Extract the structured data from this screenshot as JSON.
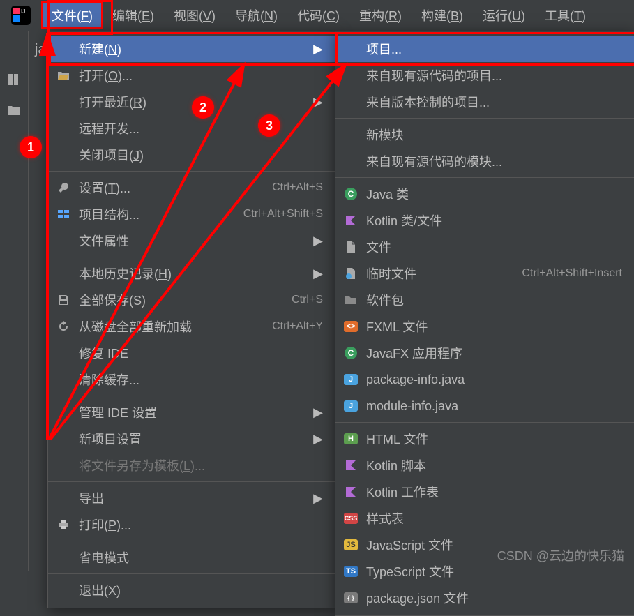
{
  "menubar": {
    "items": [
      {
        "label": "文件",
        "mn": "F"
      },
      {
        "label": "编辑",
        "mn": "E"
      },
      {
        "label": "视图",
        "mn": "V"
      },
      {
        "label": "导航",
        "mn": "N"
      },
      {
        "label": "代码",
        "mn": "C"
      },
      {
        "label": "重构",
        "mn": "R"
      },
      {
        "label": "构建",
        "mn": "B"
      },
      {
        "label": "运行",
        "mn": "U"
      },
      {
        "label": "工具",
        "mn": "T"
      }
    ]
  },
  "proj_label": "java",
  "menu1": [
    {
      "type": "item",
      "label": "新建",
      "mn": "N",
      "arrow": true,
      "hover": true,
      "icon": ""
    },
    {
      "type": "item",
      "label": "打开",
      "mn": "O",
      "suffix": "...",
      "icon": "open"
    },
    {
      "type": "item",
      "label": "打开最近",
      "mn": "R",
      "arrow": true
    },
    {
      "type": "item",
      "label": "远程开发..."
    },
    {
      "type": "item",
      "label": "关闭项目",
      "mn": "J"
    },
    {
      "type": "sep"
    },
    {
      "type": "item",
      "label": "设置",
      "mn": "T",
      "suffix": "...",
      "shortcut": "Ctrl+Alt+S",
      "icon": "wrench"
    },
    {
      "type": "item",
      "label": "项目结构...",
      "shortcut": "Ctrl+Alt+Shift+S",
      "icon": "structure"
    },
    {
      "type": "item",
      "label": "文件属性",
      "arrow": true
    },
    {
      "type": "sep"
    },
    {
      "type": "item",
      "label": "本地历史记录",
      "mn": "H",
      "arrow": true
    },
    {
      "type": "item",
      "label": "全部保存",
      "mn": "S",
      "shortcut": "Ctrl+S",
      "icon": "save"
    },
    {
      "type": "item",
      "label": "从磁盘全部重新加载",
      "shortcut": "Ctrl+Alt+Y",
      "icon": "reload"
    },
    {
      "type": "item",
      "label": "修复 IDE"
    },
    {
      "type": "item",
      "label": "清除缓存..."
    },
    {
      "type": "sep"
    },
    {
      "type": "item",
      "label": "管理 IDE 设置",
      "arrow": true
    },
    {
      "type": "item",
      "label": "新项目设置",
      "arrow": true
    },
    {
      "type": "item",
      "label": "将文件另存为模板",
      "mn": "L",
      "suffix": "...",
      "disabled": true
    },
    {
      "type": "sep"
    },
    {
      "type": "item",
      "label": "导出",
      "arrow": true
    },
    {
      "type": "item",
      "label": "打印",
      "mn": "P",
      "suffix": "...",
      "icon": "print"
    },
    {
      "type": "sep"
    },
    {
      "type": "item",
      "label": "省电模式"
    },
    {
      "type": "sep"
    },
    {
      "type": "item",
      "label": "退出",
      "mn": "X"
    }
  ],
  "menu2": [
    {
      "type": "item",
      "label": "项目...",
      "hover": true
    },
    {
      "type": "item",
      "label": "来自现有源代码的项目..."
    },
    {
      "type": "item",
      "label": "来自版本控制的项目..."
    },
    {
      "type": "sep"
    },
    {
      "type": "item",
      "label": "新模块"
    },
    {
      "type": "item",
      "label": "来自现有源代码的模块..."
    },
    {
      "type": "sep"
    },
    {
      "type": "item",
      "label": "Java 类",
      "icon": "c-badge"
    },
    {
      "type": "item",
      "label": "Kotlin 类/文件",
      "icon": "kotlin"
    },
    {
      "type": "item",
      "label": "文件",
      "icon": "file"
    },
    {
      "type": "item",
      "label": "临时文件",
      "shortcut": "Ctrl+Alt+Shift+Insert",
      "icon": "scratch"
    },
    {
      "type": "item",
      "label": "软件包",
      "icon": "folder"
    },
    {
      "type": "item",
      "label": "FXML 文件",
      "icon": "fxml"
    },
    {
      "type": "item",
      "label": "JavaFX 应用程序",
      "icon": "c-badge"
    },
    {
      "type": "item",
      "label": "package-info.java",
      "icon": "java"
    },
    {
      "type": "item",
      "label": "module-info.java",
      "icon": "java"
    },
    {
      "type": "sep"
    },
    {
      "type": "item",
      "label": "HTML 文件",
      "icon": "html"
    },
    {
      "type": "item",
      "label": "Kotlin 脚本",
      "icon": "kotlin"
    },
    {
      "type": "item",
      "label": "Kotlin 工作表",
      "icon": "kotlin"
    },
    {
      "type": "item",
      "label": "样式表",
      "icon": "css"
    },
    {
      "type": "item",
      "label": "JavaScript 文件",
      "icon": "js"
    },
    {
      "type": "item",
      "label": "TypeScript 文件",
      "icon": "ts"
    },
    {
      "type": "item",
      "label": "package.json 文件",
      "icon": "json"
    }
  ],
  "annotations": {
    "badge1": "1",
    "badge2": "2",
    "badge3": "3"
  },
  "watermark": "CSDN @云边的快乐猫"
}
